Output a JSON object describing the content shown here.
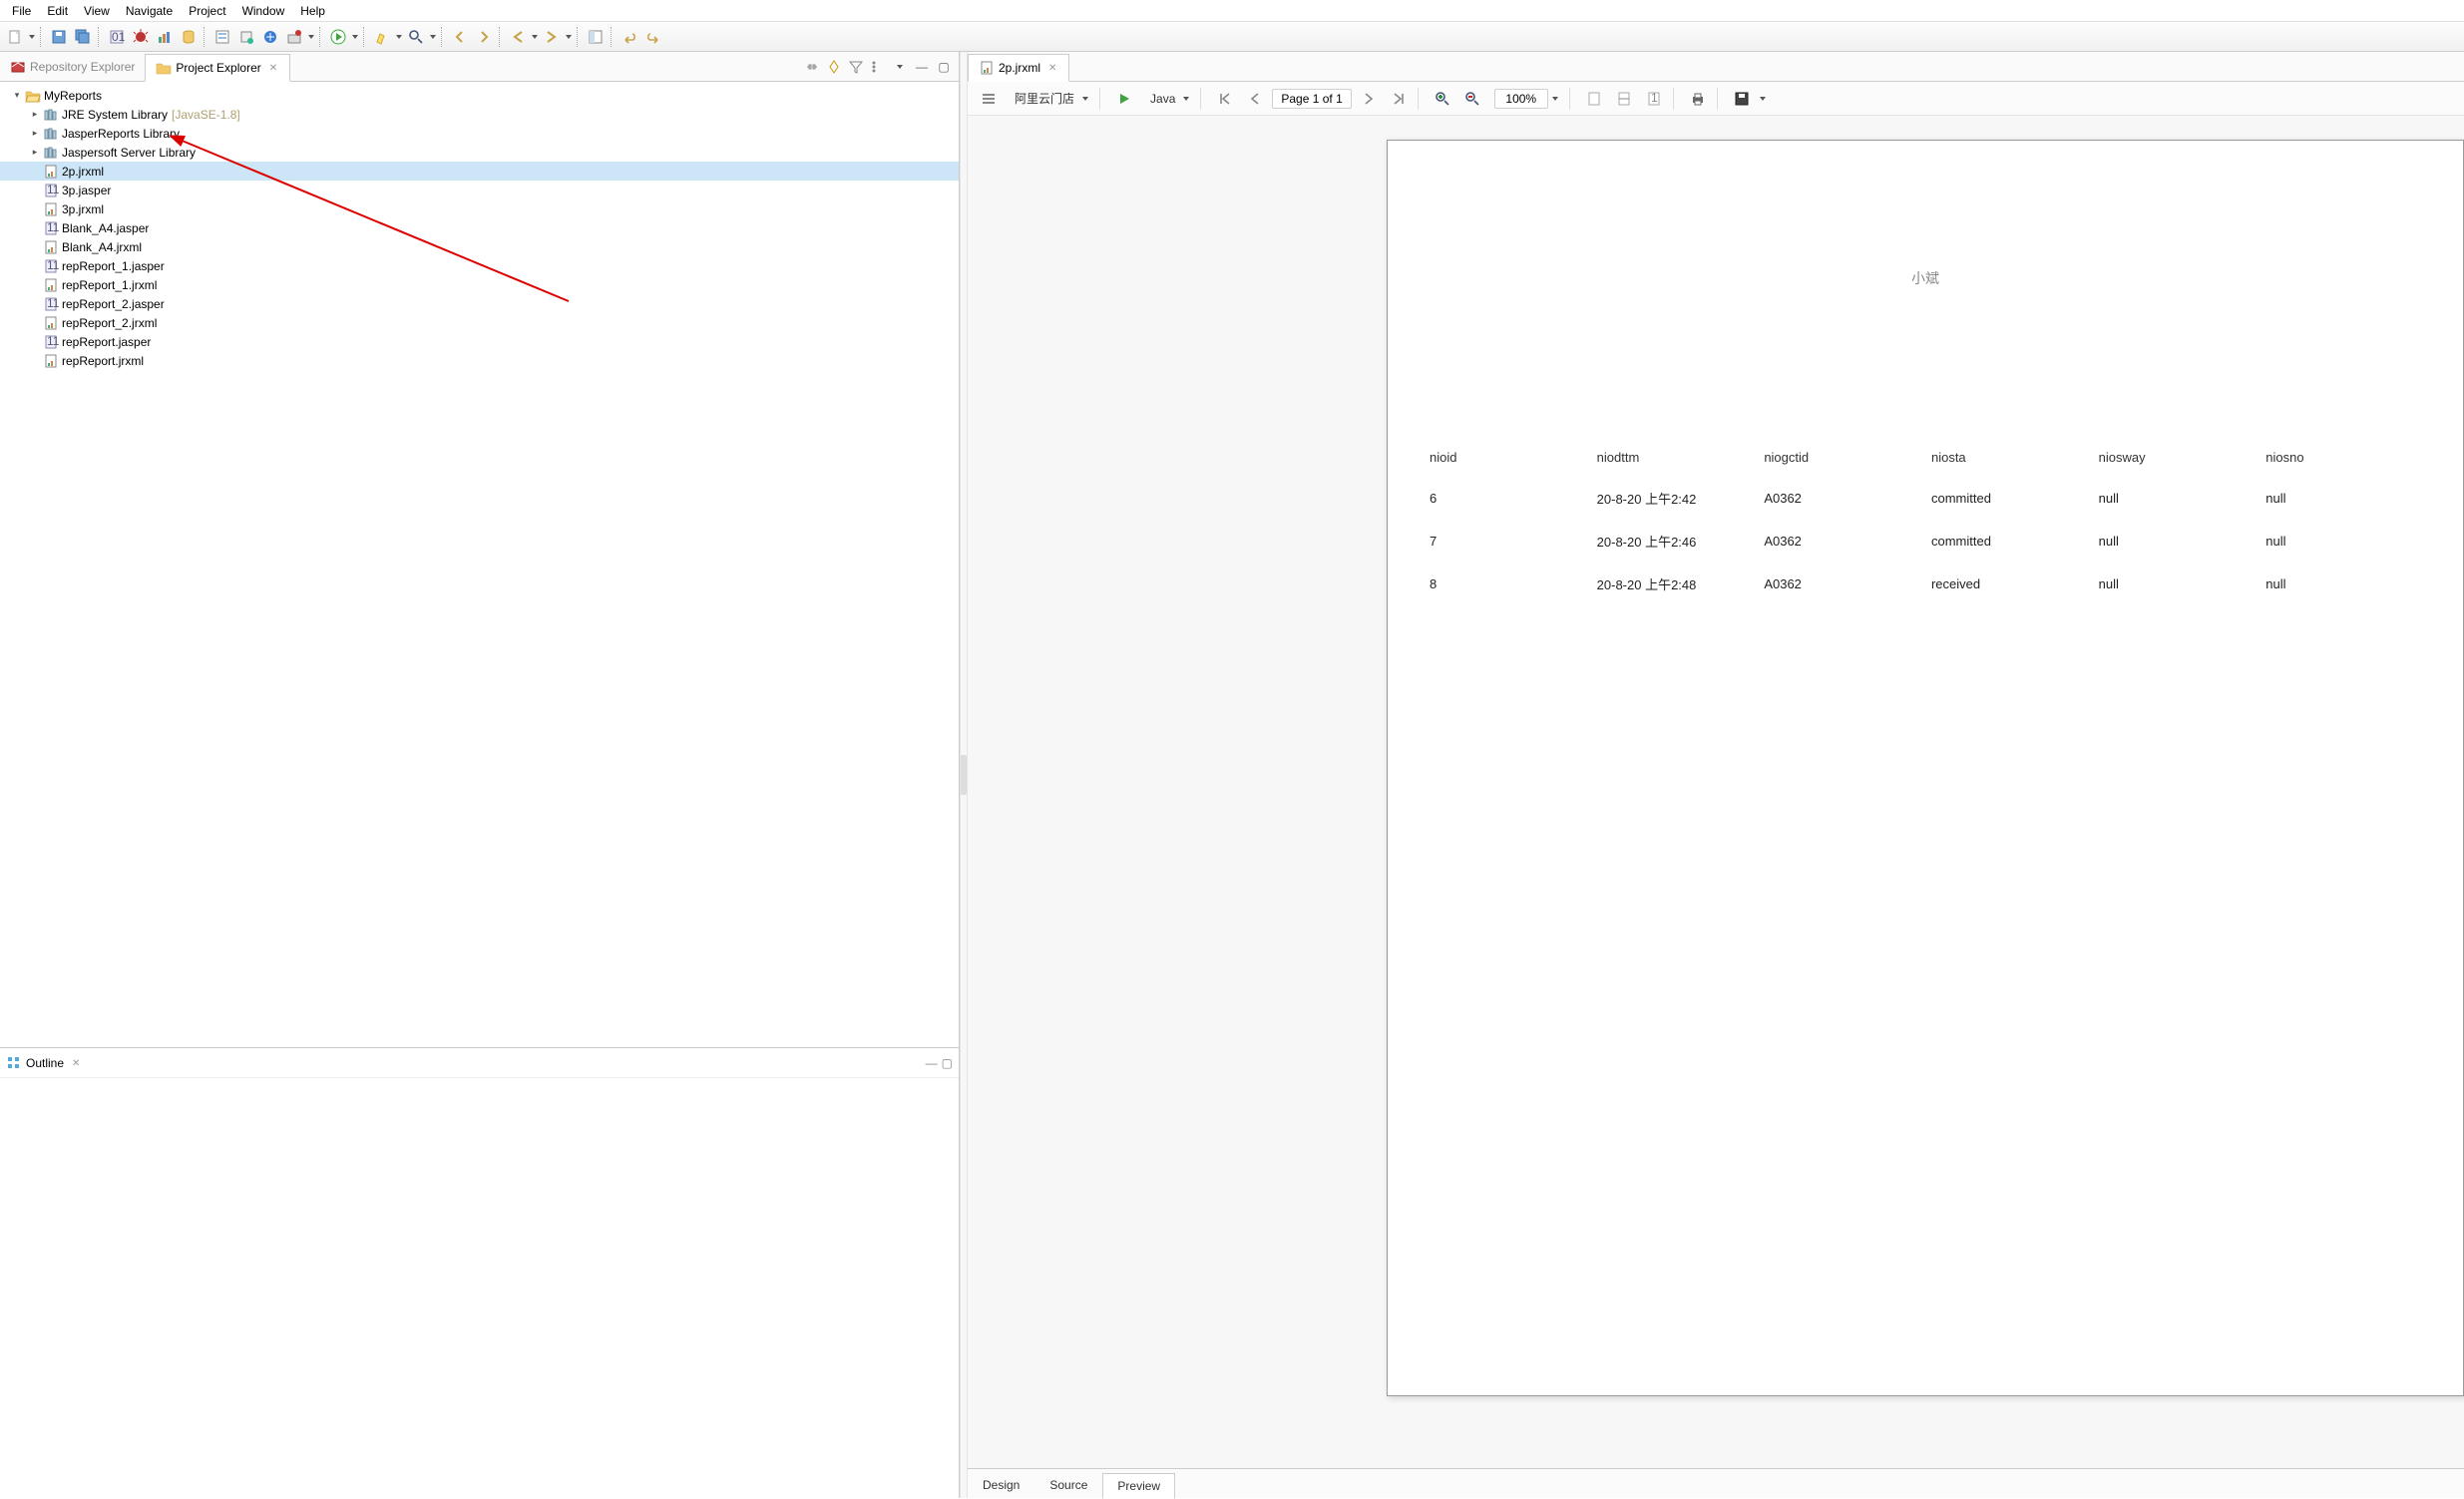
{
  "menu": {
    "items": [
      "File",
      "Edit",
      "View",
      "Navigate",
      "Project",
      "Window",
      "Help"
    ]
  },
  "views": {
    "repository": "Repository Explorer",
    "project": "Project Explorer"
  },
  "project_tree": {
    "root": "MyReports",
    "libs": [
      {
        "label": "JRE System Library",
        "suffix": "[JavaSE-1.8]"
      },
      {
        "label": "JasperReports Library",
        "suffix": ""
      },
      {
        "label": "Jaspersoft Server Library",
        "suffix": ""
      }
    ],
    "files": [
      {
        "label": "2p.jrxml",
        "type": "jrxml",
        "selected": true
      },
      {
        "label": "3p.jasper",
        "type": "jasper"
      },
      {
        "label": "3p.jrxml",
        "type": "jrxml"
      },
      {
        "label": "Blank_A4.jasper",
        "type": "jasper"
      },
      {
        "label": "Blank_A4.jrxml",
        "type": "jrxml"
      },
      {
        "label": "repReport_1.jasper",
        "type": "jasper"
      },
      {
        "label": "repReport_1.jrxml",
        "type": "jrxml"
      },
      {
        "label": "repReport_2.jasper",
        "type": "jasper"
      },
      {
        "label": "repReport_2.jrxml",
        "type": "jrxml"
      },
      {
        "label": "repReport.jasper",
        "type": "jasper"
      },
      {
        "label": "repReport.jrxml",
        "type": "jrxml"
      }
    ]
  },
  "outline": {
    "title": "Outline"
  },
  "editor": {
    "tab": "2p.jrxml",
    "datasource": "阿里云门店",
    "lang": "Java",
    "page_info": "Page 1 of 1",
    "zoom": "100%",
    "subtabs": [
      "Design",
      "Source",
      "Preview"
    ],
    "active_subtab": "Preview"
  },
  "report": {
    "watermark": "小斌",
    "columns": [
      "nioid",
      "niodttm",
      "niogctid",
      "niosta",
      "niosway",
      "niosno"
    ],
    "rows": [
      [
        "6",
        "20-8-20 上午2:42",
        "A0362",
        "committed",
        "null",
        "null"
      ],
      [
        "7",
        "20-8-20 上午2:46",
        "A0362",
        "committed",
        "null",
        "null"
      ],
      [
        "8",
        "20-8-20 上午2:48",
        "A0362",
        "received",
        "null",
        "null"
      ]
    ]
  }
}
